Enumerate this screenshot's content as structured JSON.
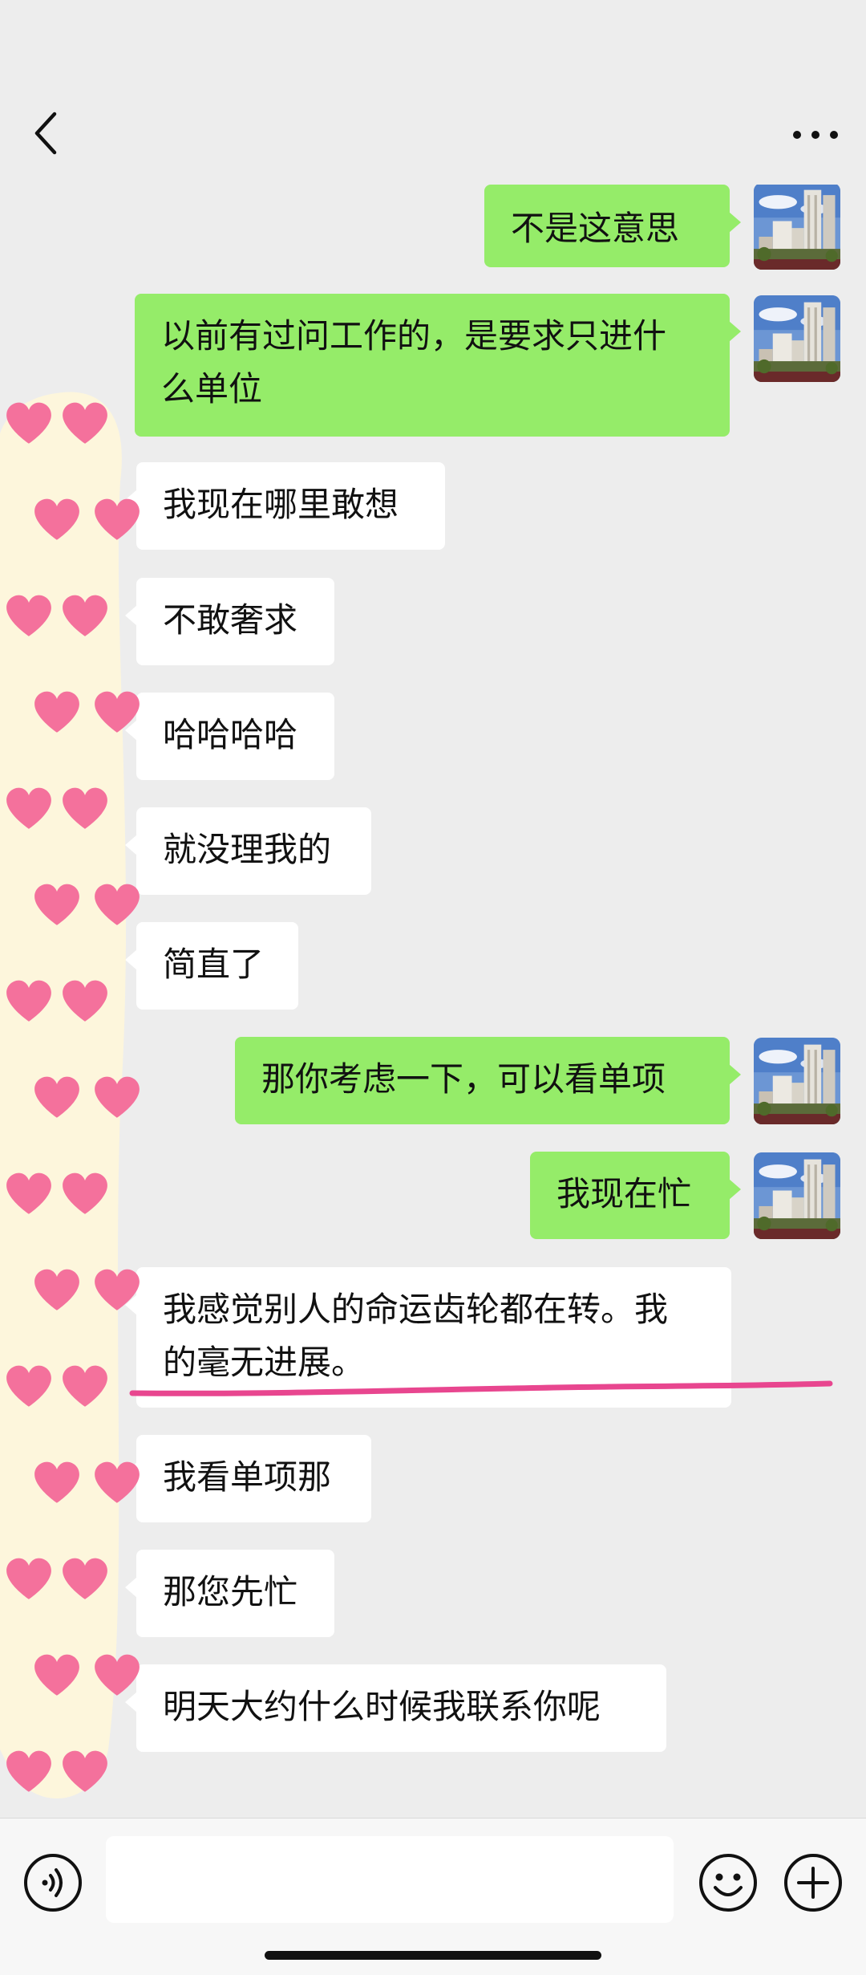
{
  "header": {
    "back_icon": "chevron-left-icon",
    "more_icon": "more-dots-icon"
  },
  "messages": [
    {
      "side": "out",
      "text": "不是这意思"
    },
    {
      "side": "out",
      "lines": [
        "以前有过问工作的，是要求只进什",
        "么单位"
      ]
    },
    {
      "side": "in",
      "text": "我现在哪里敢想"
    },
    {
      "side": "in",
      "text": "不敢奢求"
    },
    {
      "side": "in",
      "text": "哈哈哈哈"
    },
    {
      "side": "in",
      "text": "就没理我的"
    },
    {
      "side": "in",
      "text": "简直了"
    },
    {
      "side": "out",
      "text": "那你考虑一下，可以看单项"
    },
    {
      "side": "out",
      "text": "我现在忙"
    },
    {
      "side": "in",
      "lines": [
        "我感觉别人的命运齿轮都在转。我",
        "的毫无进展。"
      ]
    },
    {
      "side": "in",
      "text": "我看单项那"
    },
    {
      "side": "in",
      "text": "那您先忙"
    },
    {
      "side": "in",
      "text": "明天大约什么时候我联系你呢"
    }
  ],
  "input_bar": {
    "voice_icon": "voice-icon",
    "emoji_icon": "emoji-icon",
    "plus_icon": "plus-icon",
    "text_value": ""
  },
  "annotations": {
    "heart_color": "#f4719c",
    "underline_color": "#e8468f"
  },
  "colors": {
    "background": "#ededed",
    "outgoing_bubble": "#95ec69",
    "incoming_bubble": "#ffffff"
  }
}
